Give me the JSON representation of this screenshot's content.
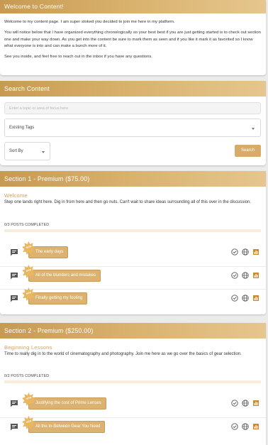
{
  "welcome": {
    "title": "Welcome to Content!",
    "paragraphs": [
      "Welcome to my content page. I am super stoked you decided to join me here in my platform.",
      "You will notice below that I have organized everything chronologically so your best best if you are just getting started is to check out section one and make your way down. As you get into the content be sure to mark them as seen and if you like it mark it as favorited so I know what everyone is into and can make a bunch more of it.",
      "See you inside, and feel free to reach out in the inbox if you have any questions."
    ]
  },
  "search": {
    "title": "Search Content",
    "placeholder": "Enter a topic or area of focus here",
    "tags_label": "Existing Tags",
    "sort_label": "Sort By",
    "button_label": "Search"
  },
  "sections": [
    {
      "title": "Section 1 - Premium ($75.00)",
      "subtitle": "Welcome",
      "description": "Step one lands right here. Dig in from here and then go nuts. Can't wait to share ideas surrounding all of this over in the discussion.",
      "progress_label": "0/3 POSTS COMPLETED",
      "progress": 0,
      "posts": [
        {
          "badge": "NEW",
          "label": "The early days"
        },
        {
          "badge": "NEW",
          "label": "All of the blunders and mistakes"
        },
        {
          "badge": "NEW",
          "label": "Finally getting my footing"
        }
      ]
    },
    {
      "title": "Section 2 - Premium ($250.00)",
      "subtitle": "Beginning Lessons",
      "description": "Time to really dig in to the world of cinematography and photography. Join me here as we go over the basics of gear selection.",
      "progress_label": "0/2 POSTS COMPLETED",
      "progress": 0,
      "posts": [
        {
          "badge": "NEW",
          "label": "Justifying the cost of Prime Lenses"
        },
        {
          "badge": "NEW",
          "label": "All the In-Between Gear You Need"
        }
      ]
    }
  ],
  "colors": {
    "accent": "#d7ac6a",
    "header_gradient_start": "#c79a52",
    "header_gradient_end": "#e6c68e",
    "subtitle": "#d6a15a",
    "icon_gray": "#555555",
    "chart_icon": "#d08a2e"
  },
  "icons": {
    "post_type": "chat-bubble-icon",
    "badge": "new-burst-icon",
    "seen": "check-circle-icon",
    "favorite": "globe-icon",
    "stats": "bar-chart-icon"
  }
}
